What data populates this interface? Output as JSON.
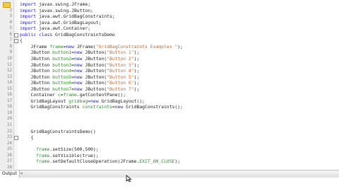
{
  "editor": {
    "lines": [
      {
        "n": "",
        "tokens": [
          {
            "c": "kw",
            "t": "import "
          },
          {
            "c": "pl",
            "t": "javax.swing.JFrame;"
          }
        ]
      },
      {
        "n": "2",
        "tokens": [
          {
            "c": "kw",
            "t": "import "
          },
          {
            "c": "pl",
            "t": "javax.swing.JButton;"
          }
        ]
      },
      {
        "n": "3",
        "tokens": [
          {
            "c": "kw",
            "t": "import "
          },
          {
            "c": "pl",
            "t": "java.awt.GridBagConstraints;"
          }
        ]
      },
      {
        "n": "4",
        "tokens": [
          {
            "c": "kw",
            "t": "import "
          },
          {
            "c": "pl",
            "t": "java.awt.GridBagLayout;"
          }
        ]
      },
      {
        "n": "5",
        "tokens": [
          {
            "c": "kw",
            "t": "import "
          },
          {
            "c": "pl",
            "t": "java.awt.Container;"
          }
        ]
      },
      {
        "n": "6",
        "tokens": [
          {
            "c": "kw",
            "t": "public class "
          },
          {
            "c": "pl",
            "t": "GridBagConstraintsDemo"
          }
        ]
      },
      {
        "n": "7",
        "tokens": [
          {
            "c": "pl",
            "t": "{"
          }
        ]
      },
      {
        "n": "8",
        "tokens": [
          {
            "c": "pl",
            "t": "    JFrame "
          },
          {
            "c": "var",
            "t": "frame"
          },
          {
            "c": "pl",
            "t": "="
          },
          {
            "c": "kw",
            "t": "new "
          },
          {
            "c": "pl",
            "t": "JFrame("
          },
          {
            "c": "str",
            "t": "\"GridBagConstraints Examples \""
          },
          {
            "c": "pl",
            "t": ");"
          }
        ]
      },
      {
        "n": "9",
        "tokens": [
          {
            "c": "pl",
            "t": "    JButton "
          },
          {
            "c": "var",
            "t": "button1"
          },
          {
            "c": "pl",
            "t": "="
          },
          {
            "c": "kw",
            "t": "new "
          },
          {
            "c": "pl",
            "t": "JButton("
          },
          {
            "c": "str",
            "t": "\"Button 1\""
          },
          {
            "c": "pl",
            "t": ");"
          }
        ]
      },
      {
        "n": "10",
        "tokens": [
          {
            "c": "pl",
            "t": "    JButton "
          },
          {
            "c": "var",
            "t": "button2"
          },
          {
            "c": "pl",
            "t": "="
          },
          {
            "c": "kw",
            "t": "new "
          },
          {
            "c": "pl",
            "t": "JButton("
          },
          {
            "c": "str",
            "t": "\"Button 2\""
          },
          {
            "c": "pl",
            "t": ");"
          }
        ]
      },
      {
        "n": "11",
        "tokens": [
          {
            "c": "pl",
            "t": "    JButton "
          },
          {
            "c": "var",
            "t": "button3"
          },
          {
            "c": "pl",
            "t": "="
          },
          {
            "c": "kw",
            "t": "new "
          },
          {
            "c": "pl",
            "t": "JButton("
          },
          {
            "c": "str",
            "t": "\"Button 3\""
          },
          {
            "c": "pl",
            "t": ");"
          }
        ]
      },
      {
        "n": "12",
        "tokens": [
          {
            "c": "pl",
            "t": "    JButton "
          },
          {
            "c": "var",
            "t": "button4"
          },
          {
            "c": "pl",
            "t": "="
          },
          {
            "c": "kw",
            "t": "new "
          },
          {
            "c": "pl",
            "t": "JButton("
          },
          {
            "c": "str",
            "t": "\"Button 4\""
          },
          {
            "c": "pl",
            "t": ");"
          }
        ]
      },
      {
        "n": "13",
        "tokens": [
          {
            "c": "pl",
            "t": "    JButton "
          },
          {
            "c": "var",
            "t": "button5"
          },
          {
            "c": "pl",
            "t": "="
          },
          {
            "c": "kw",
            "t": "new "
          },
          {
            "c": "pl",
            "t": "JButton("
          },
          {
            "c": "str",
            "t": "\"Button 5\""
          },
          {
            "c": "pl",
            "t": ");"
          }
        ]
      },
      {
        "n": "14",
        "tokens": [
          {
            "c": "pl",
            "t": "    JButton "
          },
          {
            "c": "var",
            "t": "button6"
          },
          {
            "c": "pl",
            "t": "="
          },
          {
            "c": "kw",
            "t": "new "
          },
          {
            "c": "pl",
            "t": "JButton("
          },
          {
            "c": "str",
            "t": "\"Button 6\""
          },
          {
            "c": "pl",
            "t": ");"
          }
        ]
      },
      {
        "n": "15",
        "tokens": [
          {
            "c": "pl",
            "t": "    JButton "
          },
          {
            "c": "var",
            "t": "button7"
          },
          {
            "c": "pl",
            "t": "="
          },
          {
            "c": "kw",
            "t": "new "
          },
          {
            "c": "pl",
            "t": "JButton("
          },
          {
            "c": "str",
            "t": "\"Button 7\""
          },
          {
            "c": "pl",
            "t": ");"
          }
        ]
      },
      {
        "n": "16",
        "tokens": [
          {
            "c": "pl",
            "t": "    Container "
          },
          {
            "c": "var",
            "t": "c"
          },
          {
            "c": "pl",
            "t": "="
          },
          {
            "c": "var",
            "t": "frame"
          },
          {
            "c": "pl",
            "t": ".getContentPane();"
          }
        ]
      },
      {
        "n": "17",
        "tokens": [
          {
            "c": "pl",
            "t": "    GridBagLayout "
          },
          {
            "c": "var",
            "t": "gridbag"
          },
          {
            "c": "pl",
            "t": "="
          },
          {
            "c": "kw",
            "t": "new "
          },
          {
            "c": "pl",
            "t": "GridBagLayout();"
          }
        ]
      },
      {
        "n": "18",
        "tokens": [
          {
            "c": "pl",
            "t": "    GridBagConstraints "
          },
          {
            "c": "var",
            "t": "constraints"
          },
          {
            "c": "pl",
            "t": "="
          },
          {
            "c": "kw",
            "t": "new "
          },
          {
            "c": "pl",
            "t": "GridBagConstraints();"
          }
        ]
      },
      {
        "n": "19",
        "tokens": []
      },
      {
        "n": "20",
        "tokens": []
      },
      {
        "n": "21",
        "tokens": []
      },
      {
        "n": "22",
        "tokens": [
          {
            "c": "pl",
            "t": "    GridBagConstraintsDemo()"
          }
        ]
      },
      {
        "n": "23",
        "tokens": [
          {
            "c": "pl",
            "t": "    {"
          }
        ]
      },
      {
        "n": "24",
        "tokens": []
      },
      {
        "n": "25",
        "tokens": [
          {
            "c": "pl",
            "t": "      "
          },
          {
            "c": "var",
            "t": "frame"
          },
          {
            "c": "pl",
            "t": ".setSize(500,500);"
          }
        ]
      },
      {
        "n": "26",
        "tokens": [
          {
            "c": "pl",
            "t": "      "
          },
          {
            "c": "var",
            "t": "frame"
          },
          {
            "c": "pl",
            "t": ".setVisible(true);"
          }
        ]
      },
      {
        "n": "27",
        "tokens": [
          {
            "c": "pl",
            "t": "      "
          },
          {
            "c": "var",
            "t": "frame"
          },
          {
            "c": "pl",
            "t": ".setDefaultCloseOperation(JFrame."
          },
          {
            "c": "const",
            "t": "EXIT_ON_CLOSE"
          },
          {
            "c": "pl",
            "t": ");"
          }
        ]
      },
      {
        "n": "28",
        "tokens": []
      }
    ]
  },
  "output": {
    "tab_label": "Output",
    "close_glyph": "×"
  },
  "icons": {
    "fold": "fold-toggle-icon",
    "marker": "warning-marker-icon",
    "cursor": "mouse-pointer-icon"
  },
  "colors": {
    "keyword": "#1f22b5",
    "string": "#c0662b",
    "field": "#2a8b2a",
    "line_number": "#7f7f7f"
  }
}
